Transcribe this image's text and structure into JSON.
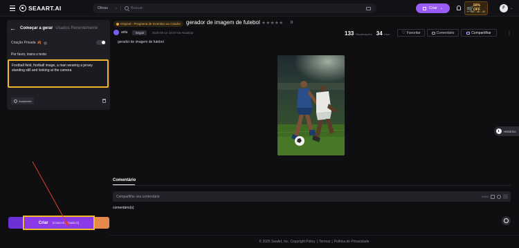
{
  "header": {
    "logo_text": "SEAART.AI",
    "search_category": "Obras",
    "search_placeholder": "Buscar",
    "create_label": "Criar",
    "promo_off": "50% OFF",
    "promo_time": "16 : 48 : 40",
    "avatar_letter": "F"
  },
  "left": {
    "tab_active": "Começar a gerar",
    "tab_inactive": "Usados Recentemente",
    "private_label": "Criação Privada",
    "private_emoji": "🍂",
    "prompt_label": "Por favor, insira o texto",
    "prompt_text": "Football field, football image, a man wearing a jersey standing still and looking at the camera",
    "assistant_label": "Assistente",
    "generate_label": "Criar",
    "generate_cost": "(Custo Estimado:5)"
  },
  "post": {
    "badge": "Original - Programa de Incentivo ao Criador",
    "title": "gerador de imagem de futebol",
    "stars": "★★★★★",
    "rating_count": "0",
    "author": "anlu",
    "follow_label": "Seguir",
    "date": "2025-08-14 15:57:03 Atualizar",
    "views": "133",
    "views_label": "Visualizações",
    "uses": "34",
    "uses_label": "Usar",
    "favorite_label": "Favoritar",
    "comment_label": "Comentário",
    "share_label": "Compartilhar",
    "prompt_caption": "gerador de imagem de futebol"
  },
  "history_label": "Histórico",
  "comments": {
    "tab": "Comentário",
    "placeholder": "Compartilhe seu comentário",
    "char_count": "0/400",
    "count": "comentário(s)"
  },
  "footer": {
    "copyright": "© 2025 SeaArt, Inc. Copyright Policy",
    "terms": "Termos",
    "privacy": "Política de Privacidade"
  }
}
